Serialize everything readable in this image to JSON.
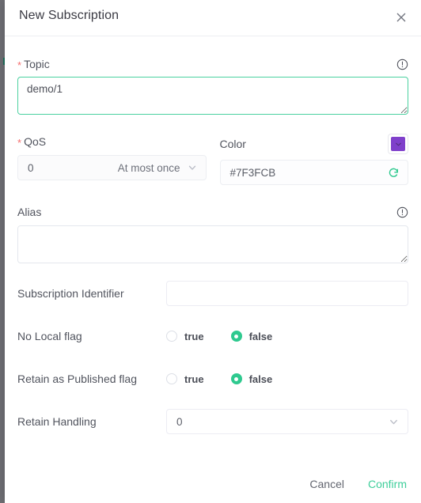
{
  "dialog": {
    "title": "New Subscription",
    "close_icon": "close-icon"
  },
  "fields": {
    "topic": {
      "label": "Topic",
      "required_mark": "*",
      "value": "demo/1",
      "placeholder": "",
      "info_icon": "info-circle-icon"
    },
    "qos": {
      "label": "QoS",
      "required_mark": "*",
      "value": "0",
      "value_hint": "At most once",
      "chevron_icon": "chevron-down-icon"
    },
    "color": {
      "label": "Color",
      "value": "#7F3FCB",
      "swatch_hex": "#7F3FCB",
      "refresh_icon": "refresh-icon",
      "swatch_chevron_icon": "chevron-down-icon"
    },
    "alias": {
      "label": "Alias",
      "value": "",
      "placeholder": "",
      "info_icon": "info-circle-icon"
    },
    "subscription_identifier": {
      "label": "Subscription Identifier",
      "value": "",
      "placeholder": ""
    },
    "no_local_flag": {
      "label": "No Local flag",
      "options": [
        {
          "label": "true",
          "selected": false
        },
        {
          "label": "false",
          "selected": true
        }
      ]
    },
    "retain_as_published_flag": {
      "label": "Retain as Published flag",
      "options": [
        {
          "label": "true",
          "selected": false
        },
        {
          "label": "false",
          "selected": true
        }
      ]
    },
    "retain_handling": {
      "label": "Retain Handling",
      "value": "0",
      "chevron_icon": "chevron-down-icon"
    }
  },
  "footer": {
    "cancel_label": "Cancel",
    "confirm_label": "Confirm"
  },
  "colors": {
    "accent_green": "#2fc98f",
    "confirm_green": "#3ece9a",
    "required_red": "#f56c6c",
    "swatch_purple": "#7F3FCB",
    "focus_border": "#4bd1a0"
  }
}
